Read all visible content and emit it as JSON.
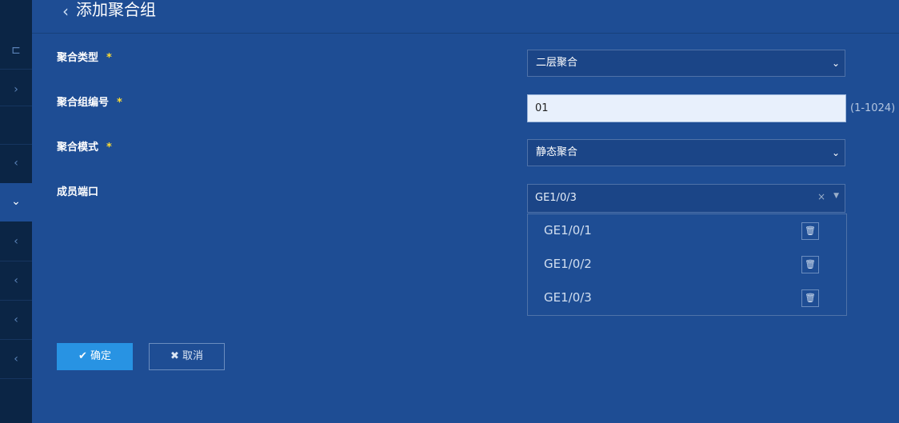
{
  "header": {
    "title": "添加聚合组",
    "back_icon": "chevron-left-icon"
  },
  "sidebar": {
    "icons": [
      "grid-icon",
      "chevron-right-icon",
      "chevron-left-icon",
      "chevron-down-icon",
      "chevron-left-icon",
      "chevron-left-icon",
      "chevron-left-icon",
      "chevron-left-icon"
    ]
  },
  "form": {
    "agg_type": {
      "label": "聚合类型",
      "required_mark": "*",
      "value": "二层聚合"
    },
    "group_id": {
      "label": "聚合组编号",
      "required_mark": "*",
      "value": "01",
      "hint": "(1-1024)"
    },
    "agg_mode": {
      "label": "聚合模式",
      "required_mark": "*",
      "value": "静态聚合"
    },
    "members": {
      "label": "成员端口",
      "selected": "GE1/0/3",
      "clear_icon": "×",
      "options": [
        "GE1/0/1",
        "GE1/0/2",
        "GE1/0/3"
      ]
    }
  },
  "buttons": {
    "confirm": "确定",
    "cancel": "取消"
  },
  "colors": {
    "background": "#1e4d94",
    "sidebar": "#0b2545",
    "primary_button": "#2893e3",
    "required_star": "#ffdd33"
  }
}
